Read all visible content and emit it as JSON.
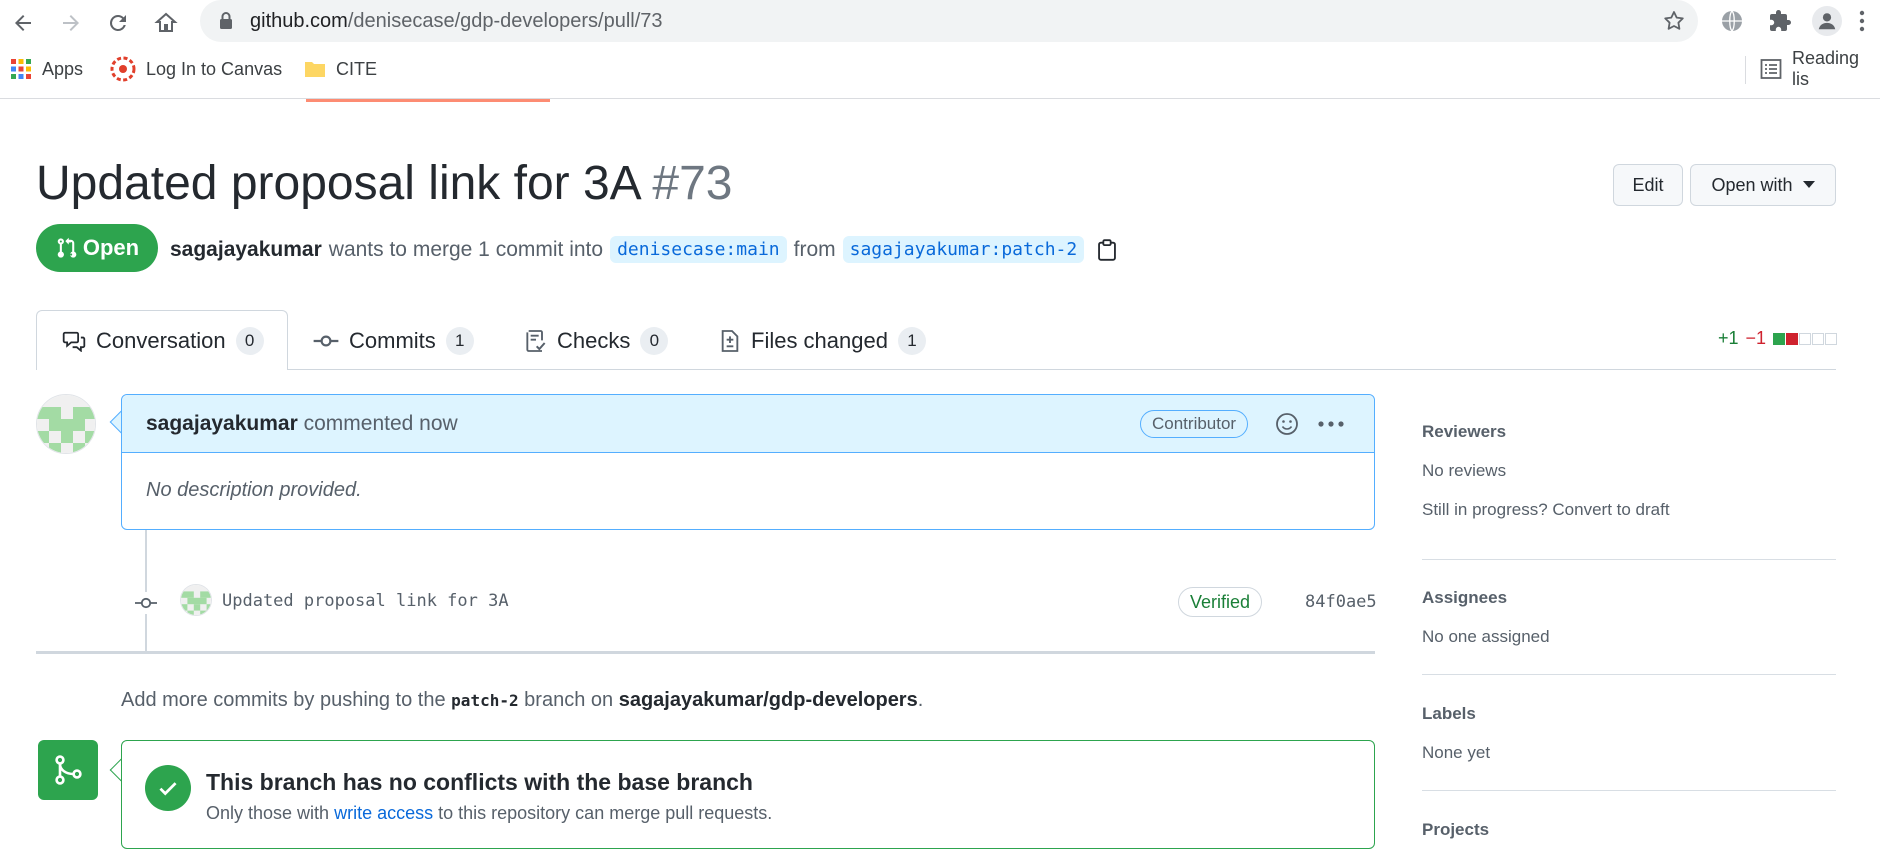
{
  "browser": {
    "url_host": "github.com",
    "url_path": "/denisecase/gdp-developers/pull/73",
    "bookmarks": [
      {
        "label": "Apps"
      },
      {
        "label": "Log In to Canvas"
      },
      {
        "label": "CITE"
      }
    ],
    "reading_list": "Reading lis"
  },
  "pr": {
    "title": "Updated proposal link for 3A",
    "number": "#73",
    "edit_label": "Edit",
    "open_with_label": "Open with",
    "state": "Open",
    "author": "sagajayakumar",
    "merge_text": "wants to merge 1 commit into",
    "base_branch": "denisecase:main",
    "from_text": "from",
    "head_branch": "sagajayakumar:patch-2"
  },
  "tabs": [
    {
      "label": "Conversation",
      "count": "0"
    },
    {
      "label": "Commits",
      "count": "1"
    },
    {
      "label": "Checks",
      "count": "0"
    },
    {
      "label": "Files changed",
      "count": "1"
    }
  ],
  "diffstat": {
    "additions": "+1",
    "deletions": "−1"
  },
  "comment": {
    "author": "sagajayakumar",
    "action": "commented now",
    "badge": "Contributor",
    "body": "No description provided."
  },
  "commit": {
    "message": "Updated proposal link for 3A",
    "verified": "Verified",
    "sha": "84f0ae5"
  },
  "add_commits": {
    "prefix": "Add more commits by pushing to the",
    "branch": "patch-2",
    "middle": "branch on",
    "repo": "sagajayakumar/gdp-developers",
    "suffix": "."
  },
  "merge_status": {
    "title": "This branch has no conflicts with the base branch",
    "sub_prefix": "Only those with",
    "link": "write access",
    "sub_suffix": "to this repository can merge pull requests."
  },
  "sidebar": {
    "reviewers_label": "Reviewers",
    "reviewers_value": "No reviews",
    "draft_hint": "Still in progress? Convert to draft",
    "assignees_label": "Assignees",
    "assignees_value": "No one assigned",
    "labels_label": "Labels",
    "labels_value": "None yet",
    "projects_label": "Projects"
  },
  "colors": {
    "open_green": "#2da44e",
    "link_blue": "#0969da",
    "comment_header": "#ddf4ff"
  }
}
